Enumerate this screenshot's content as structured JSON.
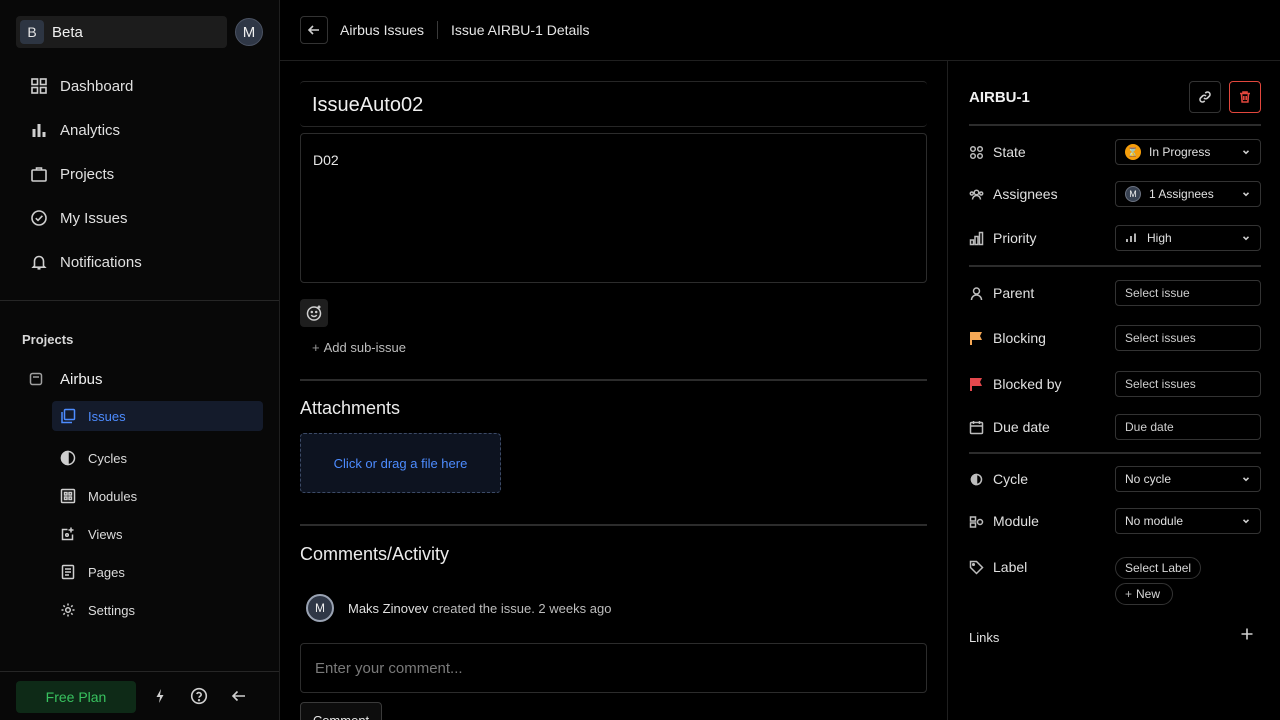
{
  "workspace": {
    "badge": "B",
    "name": "Beta",
    "user_initial": "M"
  },
  "nav": {
    "dashboard": "Dashboard",
    "analytics": "Analytics",
    "projects": "Projects",
    "my_issues": "My Issues",
    "notifications": "Notifications"
  },
  "projects_section": {
    "title": "Projects",
    "project_name": "Airbus",
    "items": {
      "issues": "Issues",
      "cycles": "Cycles",
      "modules": "Modules",
      "views": "Views",
      "pages": "Pages",
      "settings": "Settings"
    }
  },
  "footer": {
    "plan": "Free Plan"
  },
  "header": {
    "crumb_project": "Airbus Issues",
    "crumb_issue": "Issue AIRBU-1 Details"
  },
  "issue": {
    "title": "IssueAuto02",
    "description": "D02",
    "add_sub_issue": "Add sub-issue",
    "attachments_title": "Attachments",
    "dropzone_text": "Click or drag a file here",
    "activity_title": "Comments/Activity",
    "activity": {
      "avatar": "M",
      "user": "Maks Zinovev",
      "text": "created the issue. 2 weeks ago"
    },
    "comment_placeholder": "Enter your comment...",
    "comment_button": "Comment"
  },
  "panel": {
    "issue_id": "AIRBU-1",
    "state": {
      "label": "State",
      "value": "In Progress"
    },
    "assignees": {
      "label": "Assignees",
      "avatar": "M",
      "value": "1 Assignees"
    },
    "priority": {
      "label": "Priority",
      "value": "High"
    },
    "parent": {
      "label": "Parent",
      "value": "Select issue"
    },
    "blocking": {
      "label": "Blocking",
      "value": "Select issues"
    },
    "blocked_by": {
      "label": "Blocked by",
      "value": "Select issues"
    },
    "due_date": {
      "label": "Due date",
      "value": "Due date"
    },
    "cycle": {
      "label": "Cycle",
      "value": "No cycle"
    },
    "module": {
      "label": "Module",
      "value": "No module"
    },
    "label": {
      "label": "Label",
      "select": "Select Label",
      "new": "New"
    },
    "links": "Links"
  },
  "colors": {
    "accent": "#4d8cff",
    "plan_green": "#38c25f",
    "danger": "#e2473d",
    "state_in_progress": "#f59e0b",
    "blocking_flag": "#f6a855",
    "blocked_by_flag": "#e5484d"
  }
}
